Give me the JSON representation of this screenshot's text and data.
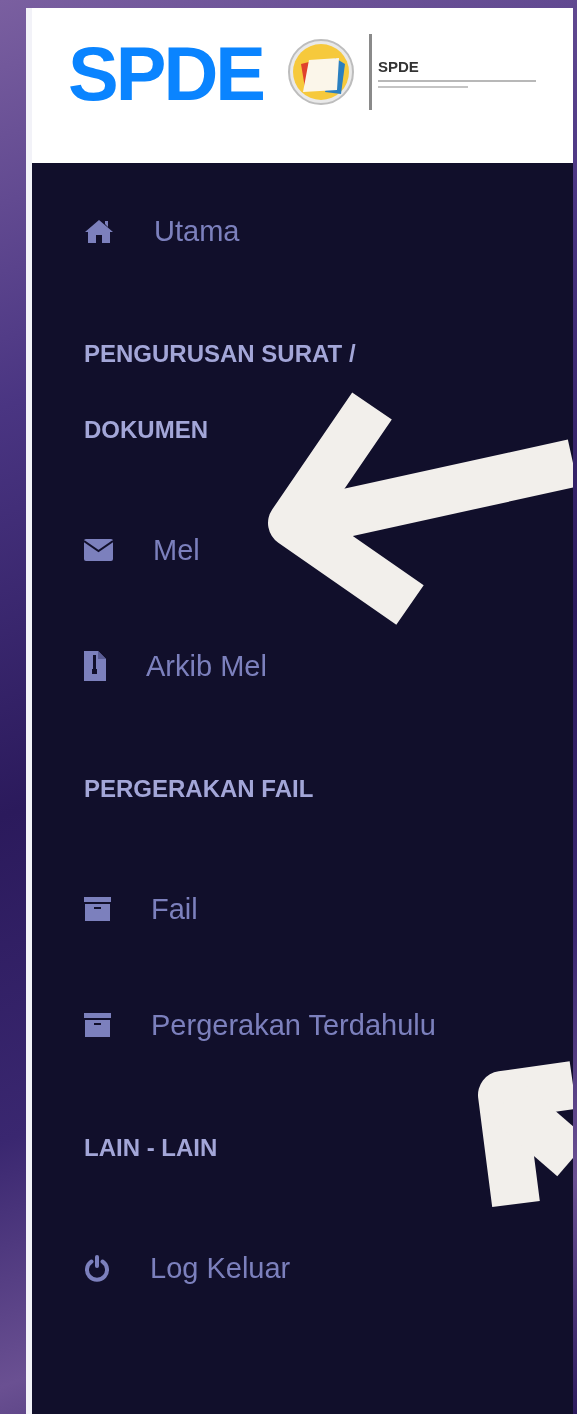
{
  "header": {
    "brand": "SPDE",
    "logo_text": "SPDE"
  },
  "menu": [
    {
      "kind": "link",
      "label": "Utama"
    },
    {
      "kind": "heading",
      "label": "PENGURUSAN SURAT / DOKUMEN"
    },
    {
      "kind": "link",
      "label": "Mel"
    },
    {
      "kind": "link",
      "label": "Arkib Mel"
    },
    {
      "kind": "heading",
      "label": "PERGERAKAN FAIL"
    },
    {
      "kind": "link",
      "label": "Fail"
    },
    {
      "kind": "link",
      "label": "Pergerakan Terdahulu"
    },
    {
      "kind": "heading",
      "label": "LAIN - LAIN"
    },
    {
      "kind": "link",
      "label": "Log Keluar"
    }
  ],
  "annotations": [
    {
      "kind": "arrow"
    },
    {
      "kind": "arrow"
    }
  ]
}
